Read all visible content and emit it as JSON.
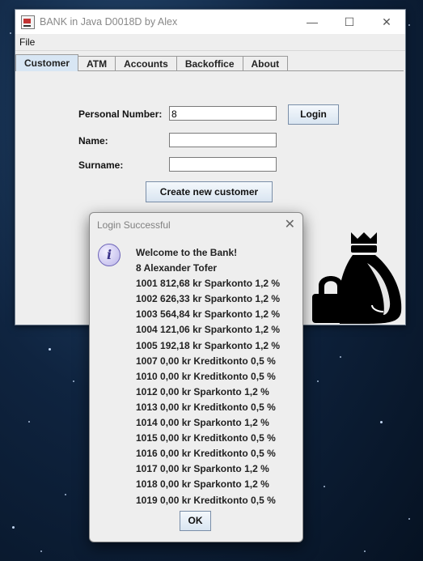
{
  "window": {
    "title": "BANK in Java D0018D by Alex",
    "controls": {
      "minimize": "—",
      "maximize": "☐",
      "close": "✕"
    }
  },
  "menu": {
    "file": "File"
  },
  "tabs": [
    {
      "label": "Customer",
      "active": true
    },
    {
      "label": "ATM",
      "active": false
    },
    {
      "label": "Accounts",
      "active": false
    },
    {
      "label": "Backoffice",
      "active": false
    },
    {
      "label": "About",
      "active": false
    }
  ],
  "customer_form": {
    "personal_number_label": "Personal Number:",
    "personal_number_value": "8",
    "login_button": "Login",
    "name_label": "Name:",
    "name_value": "",
    "surname_label": "Surname:",
    "surname_value": "",
    "create_button": "Create new customer"
  },
  "dialog": {
    "title": "Login Successful",
    "close": "✕",
    "icon": "information-icon",
    "lines": [
      "Welcome to the Bank!",
      "8 Alexander Tofer",
      "1001 812,68 kr Sparkonto 1,2 %",
      "1002 626,33 kr Sparkonto 1,2 %",
      "1003 564,84 kr Sparkonto 1,2 %",
      "1004 121,06 kr Sparkonto 1,2 %",
      "1005 192,18 kr Sparkonto 1,2 %",
      "1007 0,00 kr Kreditkonto 0,5 %",
      "1010 0,00 kr Kreditkonto 0,5 %",
      "1012 0,00 kr Sparkonto 1,2 %",
      "1013 0,00 kr Kreditkonto 0,5 %",
      "1014 0,00 kr Sparkonto 1,2 %",
      "1015 0,00 kr Kreditkonto 0,5 %",
      "1016 0,00 kr Kreditkonto 0,5 %",
      "1017 0,00 kr Sparkonto 1,2 %",
      "1018 0,00 kr Sparkonto 1,2 %",
      "1019 0,00 kr Kreditkonto 0,5 %"
    ],
    "ok_button": "OK"
  },
  "decor": {
    "logo": "money-bag-lock-icon"
  },
  "colors": {
    "active_tab": "#d8e6f4",
    "desktop": "#0f2440",
    "button_border": "#7a8ea8"
  }
}
